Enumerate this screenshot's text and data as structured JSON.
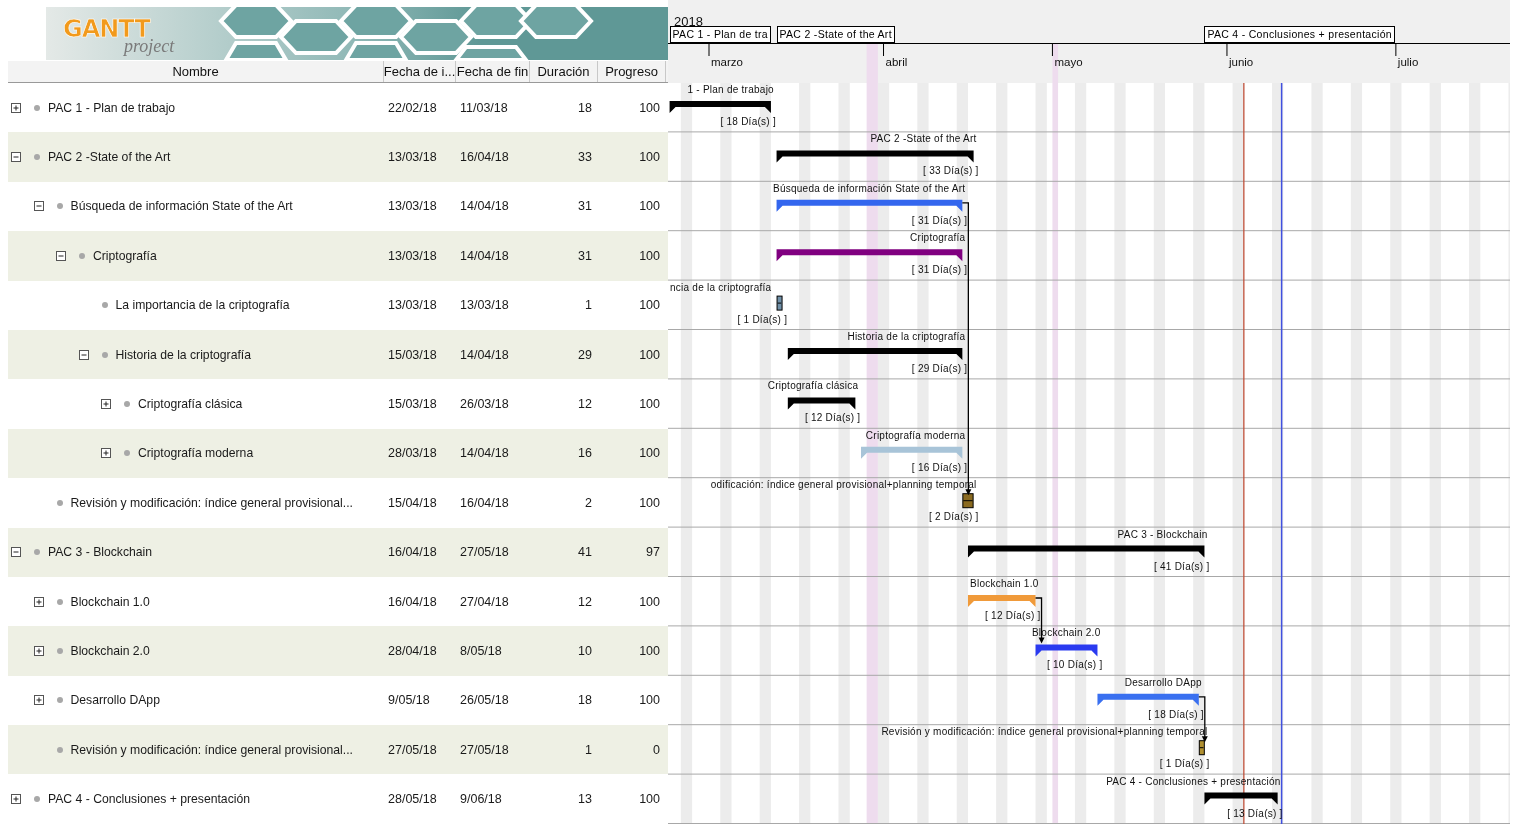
{
  "logo": {
    "brand": "GANTT",
    "tagline": "project"
  },
  "columns": [
    "Nombre",
    "Fecha de i...",
    "Fecha de fin",
    "Duración",
    "Progreso"
  ],
  "timeline": {
    "year": "2018",
    "months": [
      "marzo",
      "abril",
      "mayo",
      "junio",
      "julio"
    ]
  },
  "tasks": [
    {
      "name": "PAC 1 - Plan de trabajo",
      "start": "22/02/18",
      "end": "11/03/18",
      "duration": "18",
      "progress": "100",
      "expanded": false,
      "kind": "summary",
      "timeline_label": "PAC 1 - Plan de tra",
      "bar_label": "1 - Plan de trabajo",
      "bar_duration": "[ 18 Día(s) ]"
    },
    {
      "name": "PAC 2 -State of the Art",
      "start": "13/03/18",
      "end": "16/04/18",
      "duration": "33",
      "progress": "100",
      "expanded": true,
      "kind": "summary",
      "timeline_label": "PAC 2 -State of the Art",
      "bar_label": "PAC 2 -State of the Art",
      "bar_duration": "[ 33 Día(s) ]",
      "children": [
        {
          "name": "Búsqueda de información State of the Art",
          "start": "13/03/18",
          "end": "14/04/18",
          "duration": "31",
          "progress": "100",
          "expanded": true,
          "kind": "task",
          "color": "#3366ee",
          "bar_label": "Búsqueda de información State of the Art",
          "bar_duration": "[ 31 Día(s) ]",
          "children": [
            {
              "name": "Criptografía",
              "start": "13/03/18",
              "end": "14/04/18",
              "duration": "31",
              "progress": "100",
              "expanded": true,
              "kind": "task",
              "color": "#800080",
              "bar_label": "Criptografía",
              "bar_duration": "[ 31 Día(s) ]",
              "children": [
                {
                  "name": "La importancia de la criptografía",
                  "start": "13/03/18",
                  "end": "13/03/18",
                  "duration": "1",
                  "progress": "100",
                  "kind": "box",
                  "color": "#7090a8",
                  "bar_label": "ncia de la criptografía",
                  "bar_duration": "[ 1 Día(s) ]"
                },
                {
                  "name": "Historia de la criptografía",
                  "start": "15/03/18",
                  "end": "14/04/18",
                  "duration": "29",
                  "progress": "100",
                  "expanded": true,
                  "kind": "summary",
                  "bar_label": "Historia de la criptografía",
                  "bar_duration": "[ 29 Día(s) ]",
                  "children": [
                    {
                      "name": "Criptografía clásica",
                      "start": "15/03/18",
                      "end": "26/03/18",
                      "duration": "12",
                      "progress": "100",
                      "expanded": false,
                      "kind": "summary",
                      "bar_label": "Criptografía clásica",
                      "bar_duration": "[ 12 Día(s) ]"
                    },
                    {
                      "name": "Criptografía moderna",
                      "start": "28/03/18",
                      "end": "14/04/18",
                      "duration": "16",
                      "progress": "100",
                      "expanded": false,
                      "kind": "task",
                      "color": "#a8c4d8",
                      "bar_label": "Criptografía moderna",
                      "bar_duration": "[ 16 Día(s) ]"
                    }
                  ]
                }
              ]
            }
          ]
        },
        {
          "name": "Revisión y modificación: índice general provisional...",
          "start": "15/04/18",
          "end": "16/04/18",
          "duration": "2",
          "progress": "100",
          "kind": "box",
          "color": "#8a6a20",
          "incoming_link": true,
          "bar_label": "odificación: índice general provisional+planning temporal",
          "bar_duration": "[ 2 Día(s) ]"
        }
      ]
    },
    {
      "name": "PAC 3 - Blockchain",
      "start": "16/04/18",
      "end": "27/05/18",
      "duration": "41",
      "progress": "97",
      "expanded": true,
      "kind": "summary",
      "bar_label": "PAC 3 - Blockchain",
      "bar_duration": "[ 41 Día(s) ]",
      "children": [
        {
          "name": "Blockchain 1.0",
          "start": "16/04/18",
          "end": "27/04/18",
          "duration": "12",
          "progress": "100",
          "expanded": false,
          "kind": "task",
          "color": "#f09a3a",
          "bar_label": "Blockchain 1.0",
          "bar_duration": "[ 12 Día(s) ]"
        },
        {
          "name": "Blockchain 2.0",
          "start": "28/04/18",
          "end": "8/05/18",
          "duration": "10",
          "progress": "100",
          "expanded": false,
          "kind": "task",
          "color": "#2a3af0",
          "incoming_link": true,
          "bar_label": "Blockchain 2.0",
          "bar_duration": "[ 10 Día(s) ]"
        },
        {
          "name": "Desarrollo DApp",
          "start": "9/05/18",
          "end": "26/05/18",
          "duration": "18",
          "progress": "100",
          "expanded": false,
          "kind": "task",
          "color": "#3a70f0",
          "bar_label": "Desarrollo DApp",
          "bar_duration": "[ 18 Día(s) ]"
        },
        {
          "name": "Revisión y modificación: índice general provisional...",
          "start": "27/05/18",
          "end": "27/05/18",
          "duration": "1",
          "progress": "0",
          "kind": "box",
          "color": "#b09030",
          "incoming_link": true,
          "bar_label": "Revisión y modificación: índice general provisional+planning temporal",
          "bar_duration": "[ 1 Día(s) ]"
        }
      ]
    },
    {
      "name": "PAC 4 - Conclusiones + presentación",
      "start": "28/05/18",
      "end": "9/06/18",
      "duration": "13",
      "progress": "100",
      "expanded": false,
      "kind": "summary",
      "timeline_label": "PAC 4 - Conclusiones + presentación",
      "bar_label": "PAC 4 - Conclusiones + presentación",
      "bar_duration": "[ 13 Día(s) ]"
    }
  ]
}
